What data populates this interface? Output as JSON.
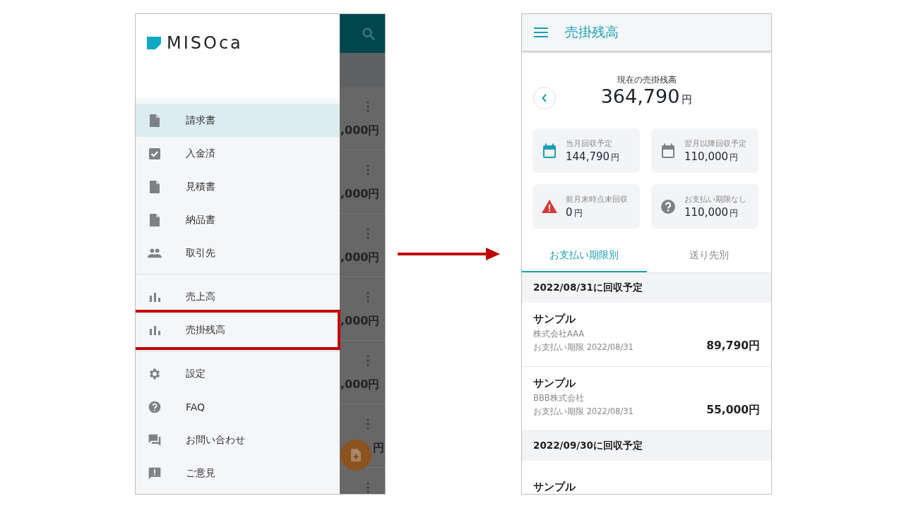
{
  "drawer": {
    "logo": "MISOca",
    "sections": [
      {
        "items": [
          {
            "kind": "document",
            "label": "請求書",
            "selected": true,
            "highlighted": false
          },
          {
            "kind": "checkbox",
            "label": "入金済",
            "selected": false,
            "highlighted": false
          },
          {
            "kind": "document",
            "label": "見積書",
            "selected": false,
            "highlighted": false
          },
          {
            "kind": "document",
            "label": "納品書",
            "selected": false,
            "highlighted": false
          },
          {
            "kind": "people",
            "label": "取引先",
            "selected": false,
            "highlighted": false
          }
        ]
      },
      {
        "items": [
          {
            "kind": "bars",
            "label": "売上高",
            "selected": false,
            "highlighted": false
          },
          {
            "kind": "bars",
            "label": "売掛残高",
            "selected": false,
            "highlighted": true
          }
        ]
      },
      {
        "items": [
          {
            "kind": "gear",
            "label": "設定",
            "selected": false,
            "highlighted": false
          },
          {
            "kind": "help",
            "label": "FAQ",
            "selected": false,
            "highlighted": false
          },
          {
            "kind": "chat",
            "label": "お問い合わせ",
            "selected": false,
            "highlighted": false
          },
          {
            "kind": "feedback",
            "label": "ご意見",
            "selected": false,
            "highlighted": false
          }
        ]
      }
    ]
  },
  "background_list": {
    "rows": [
      {
        "amount": ",000円"
      },
      {
        "amount": ",000円"
      },
      {
        "amount": ",000円"
      },
      {
        "amount": ",000円"
      },
      {
        "amount": ",000円"
      },
      {
        "amount": "円"
      },
      {}
    ]
  },
  "screen": {
    "title": "売掛残高",
    "summary": {
      "label": "現在の売掛残高",
      "amount": "364,790",
      "unit": "円"
    },
    "cards": [
      {
        "kind": "calendar-current",
        "label": "当月回収予定",
        "amount": "144,790",
        "unit": "円"
      },
      {
        "kind": "calendar",
        "label": "翌月以降回収予定",
        "amount": "110,000",
        "unit": "円"
      },
      {
        "kind": "warning",
        "label": "前月末時点未回収",
        "amount": "0",
        "unit": "円"
      },
      {
        "kind": "help",
        "label": "お支払い期限なし",
        "amount": "110,000",
        "unit": "円"
      }
    ],
    "tabs": [
      {
        "label": "お支払い期限別",
        "selected": true
      },
      {
        "label": "送り先別",
        "selected": false
      }
    ],
    "groups": [
      {
        "header": "2022/08/31に回収予定",
        "items": [
          {
            "title": "サンプル",
            "client": "株式会社AAA",
            "due": "お支払い期限 2022/08/31",
            "amount": "89,790円"
          },
          {
            "title": "サンプル",
            "client": "BBB株式会社",
            "due": "お支払い期限 2022/08/31",
            "amount": "55,000円"
          }
        ]
      },
      {
        "header": "2022/09/30に回収予定",
        "items": [
          {
            "title": "サンプル"
          }
        ]
      }
    ]
  }
}
